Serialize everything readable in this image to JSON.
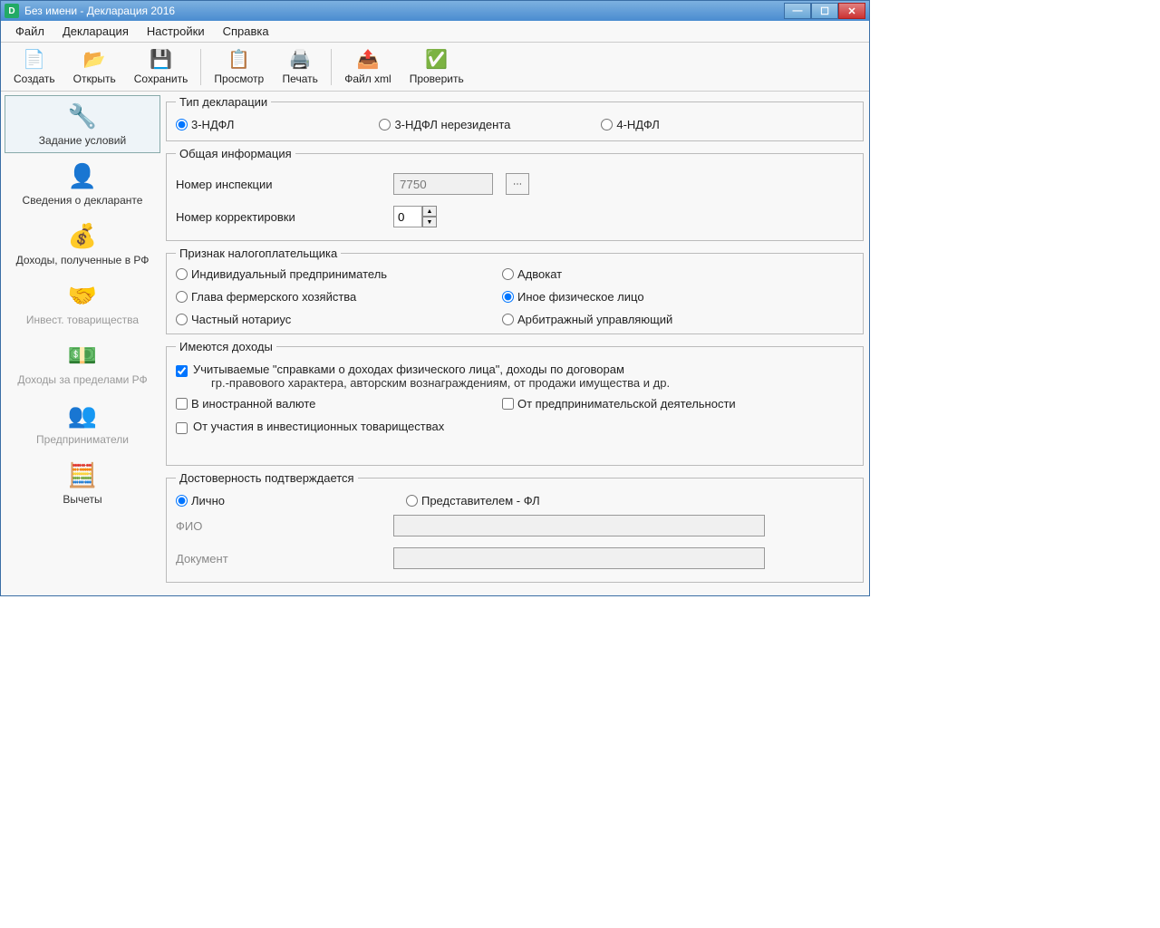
{
  "titlebar": {
    "title": "Без имени - Декларация 2016",
    "app_icon_letter": "D"
  },
  "menubar": {
    "file": "Файл",
    "declaration": "Декларация",
    "settings": "Настройки",
    "help": "Справка"
  },
  "toolbar": {
    "create": "Создать",
    "open": "Открыть",
    "save": "Сохранить",
    "preview": "Просмотр",
    "print": "Печать",
    "filexml": "Файл xml",
    "check": "Проверить"
  },
  "sidebar": {
    "conditions": "Задание условий",
    "declarant": "Сведения о декларанте",
    "income_rf": "Доходы, полученные в РФ",
    "invest": "Инвест. товарищества",
    "income_foreign": "Доходы за пределами РФ",
    "entrepreneur": "Предприниматели",
    "deductions": "Вычеты"
  },
  "decl_type": {
    "legend": "Тип декларации",
    "opt1": "3-НДФЛ",
    "opt2": "3-НДФЛ нерезидента",
    "opt3": "4-НДФЛ"
  },
  "general": {
    "legend": "Общая информация",
    "inspection_label": "Номер инспекции",
    "inspection_value": "7750",
    "correction_label": "Номер корректировки",
    "correction_value": "0"
  },
  "taxpayer": {
    "legend": "Признак налогоплательщика",
    "opt1": "Индивидуальный предприниматель",
    "opt2": "Глава фермерского хозяйства",
    "opt3": "Частный нотариус",
    "opt4": "Адвокат",
    "opt5": "Иное физическое лицо",
    "opt6": "Арбитражный управляющий"
  },
  "income_types": {
    "legend": "Имеются доходы",
    "chk1_line1": "Учитываемые \"справками о доходах физического лица\", доходы по договорам",
    "chk1_line2": "гр.-правового характера, авторским вознаграждениям, от продажи имущества и др.",
    "chk2": "В иностранной валюте",
    "chk3": "От предпринимательской деятельности",
    "chk4": "От участия в инвестиционных товариществах"
  },
  "confirmation": {
    "legend": "Достоверность подтверждается",
    "opt1": "Лично",
    "opt2": "Представителем - ФЛ",
    "fio_label": "ФИО",
    "doc_label": "Документ"
  }
}
